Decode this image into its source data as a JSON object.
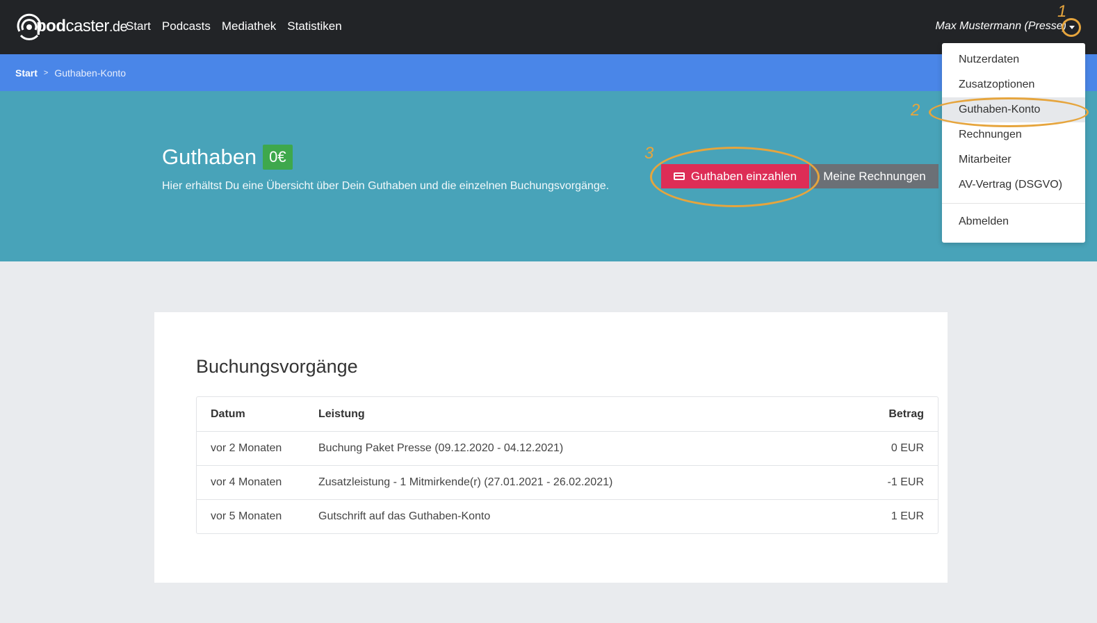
{
  "brand": {
    "logo_pre": "pod",
    "logo_mid": "caster",
    "logo_tld": ".de"
  },
  "nav": {
    "items": [
      "Start",
      "Podcasts",
      "Mediathek",
      "Statistiken"
    ]
  },
  "user": {
    "name": "Max Mustermann (Presse)"
  },
  "breadcrumb": {
    "start": "Start",
    "separator": ">",
    "current": "Guthaben-Konto"
  },
  "hero": {
    "title": "Guthaben",
    "balance": "0€",
    "subtitle": "Hier erhältst Du eine Übersicht über Dein Guthaben und die einzelnen Buchungsvorgänge.",
    "pay_button": "Guthaben einzahlen",
    "invoices_button": "Meine Rechnungen"
  },
  "dropdown": {
    "items": [
      "Nutzerdaten",
      "Zusatzoptionen",
      "Guthaben-Konto",
      "Rechnungen",
      "Mitarbeiter",
      "AV-Vertrag (DSGVO)"
    ],
    "logout": "Abmelden",
    "active": "Guthaben-Konto"
  },
  "annotations": [
    "1",
    "2",
    "3"
  ],
  "bookings": {
    "title": "Buchungsvorgänge",
    "columns": [
      "Datum",
      "Leistung",
      "Betrag"
    ],
    "rows": [
      {
        "date": "vor 2 Monaten",
        "service": "Buchung Paket Presse (09.12.2020 - 04.12.2021)",
        "amount": "0 EUR"
      },
      {
        "date": "vor 4 Monaten",
        "service": "Zusatzleistung - 1 Mitmirkende(r) (27.01.2021 - 26.02.2021)",
        "amount": "-1 EUR"
      },
      {
        "date": "vor 5 Monaten",
        "service": "Gutschrift auf das Guthaben-Konto",
        "amount": "1 EUR"
      }
    ]
  },
  "colors": {
    "navbar": "#222427",
    "breadcrumb": "#4a86e8",
    "hero": "#48a3b9",
    "pay_button": "#dd2d56",
    "invoices_button": "#6b7076",
    "balance_badge": "#3ea84c",
    "annotation": "#e6a53d"
  },
  "icons": {
    "logo": "podcast-signal-icon",
    "caret": "caret-down-icon",
    "card": "credit-card-icon"
  }
}
